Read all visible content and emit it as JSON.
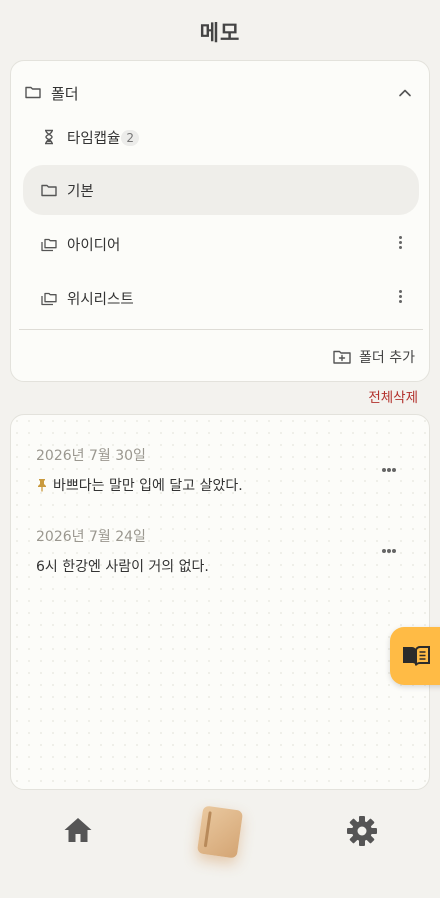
{
  "header": {
    "title": "메모"
  },
  "folders": {
    "title": "폴더",
    "items": [
      {
        "label": "타임캡슐",
        "badge": "2",
        "icon": "hourglass-icon"
      },
      {
        "label": "기본",
        "icon": "folder-icon",
        "active": true
      },
      {
        "label": "아이디어",
        "icon": "folders-stack-icon"
      },
      {
        "label": "위시리스트",
        "icon": "folders-stack-icon"
      }
    ],
    "add_label": "폴더 추가"
  },
  "delete_all_label": "전체삭제",
  "memos": [
    {
      "date": "2026년 7월 30일",
      "text": "바쁘다는 말만 입에 달고 살았다.",
      "pinned": true
    },
    {
      "date": "2026년 7월 24일",
      "text": "6시 한강엔 사람이 거의 없다.",
      "pinned": false
    }
  ],
  "colors": {
    "accent": "#ffbb45",
    "danger": "#b3322d",
    "background": "#f3f2ee",
    "card": "#fcfcf9"
  },
  "nav": {
    "items": [
      "home-icon",
      "memo-book-icon",
      "gear-icon"
    ]
  },
  "fab": {
    "icon": "book-open-icon"
  }
}
